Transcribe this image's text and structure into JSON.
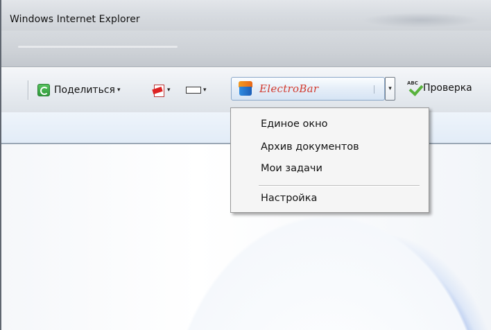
{
  "window": {
    "title": "Windows Internet Explorer"
  },
  "toolbar": {
    "share_label": "Поделиться",
    "electrobar_label": "ElectroBar",
    "spellcheck_label": "Проверка",
    "icons": {
      "share": "share-icon",
      "pdf": "pdf-icon",
      "rect": "window-rect-icon",
      "electrobar": "electrobar-logo-icon",
      "spell": "spellcheck-icon"
    }
  },
  "menu": {
    "items": [
      "Единое окно",
      "Архив документов",
      "Мои задачи"
    ],
    "settings": "Настройка"
  },
  "colors": {
    "electrobar_text": "#d23a2e",
    "menu_bg": "#f5f5f5"
  }
}
